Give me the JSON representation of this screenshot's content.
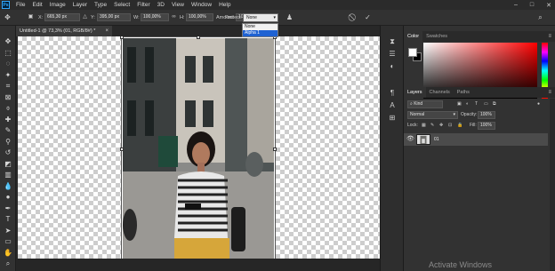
{
  "app": {
    "logo": "Ps"
  },
  "menubar": {
    "items": [
      "File",
      "Edit",
      "Image",
      "Layer",
      "Type",
      "Select",
      "Filter",
      "3D",
      "View",
      "Window",
      "Help"
    ],
    "window_controls": [
      "–",
      "□",
      "✕"
    ]
  },
  "options": {
    "x_label": "X:",
    "x_value": "665,30 px",
    "y_label": "Y:",
    "y_value": "395,00 px",
    "w_label": "W:",
    "w_value": "100,00%",
    "h_label": "H:",
    "h_value": "100,00%",
    "amount_label": "Amount:",
    "amount_value": "100%",
    "protect_label": "Protect:",
    "protect_value": "None",
    "protect_options": [
      "None",
      "Alpha 1"
    ],
    "cancel_icon": "cancel-icon",
    "commit_icon": "checkmark-icon"
  },
  "document": {
    "tab_title": "Untitled-1 @ 73,3% (01, RGB/8#) *",
    "close": "×"
  },
  "color_panel": {
    "tabs": [
      "Color",
      "Swatches"
    ],
    "foreground": "#ffffff",
    "background": "#000000"
  },
  "layers_panel": {
    "tabs": [
      "Layers",
      "Channels",
      "Paths"
    ],
    "filter_placeholder": "Kind",
    "blend_mode": "Normal",
    "opacity_label": "Opacity:",
    "opacity_value": "100%",
    "lock_label": "Lock:",
    "fill_label": "Fill:",
    "fill_value": "100%",
    "layers": [
      {
        "name": "01"
      }
    ]
  },
  "watermark": "Activate Windows"
}
